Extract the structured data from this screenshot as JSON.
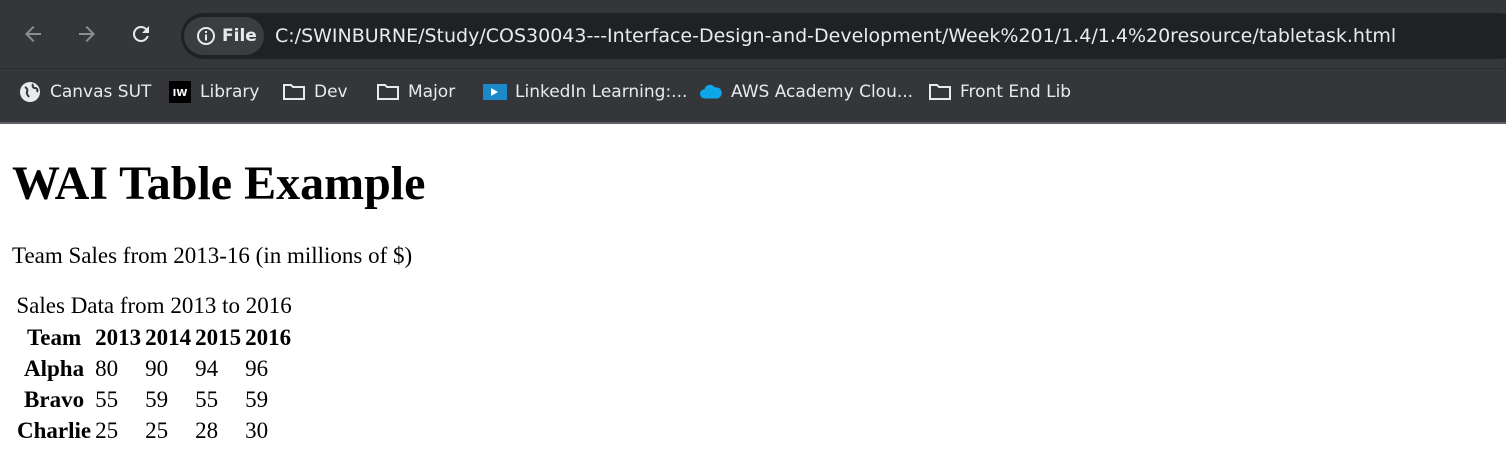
{
  "browser": {
    "nav": {
      "back_icon": "arrow-left-icon",
      "forward_icon": "arrow-right-icon",
      "reload_icon": "reload-icon"
    },
    "omnibox": {
      "scheme_chip_icon": "info-icon",
      "scheme_chip_label": "File",
      "url": "C:/SWINBURNE/Study/COS30043---Interface-Design-and-Development/Week%201/1.4/1.4%20resource/tabletask.html"
    },
    "bookmarks": [
      {
        "icon": "globe-icon",
        "label": "Canvas SUT"
      },
      {
        "icon": "iw-logo-icon",
        "label": "Library"
      },
      {
        "icon": "folder-icon",
        "label": "Dev"
      },
      {
        "icon": "folder-icon",
        "label": "Major"
      },
      {
        "icon": "linkedin-learning-icon",
        "label": "LinkedIn Learning:..."
      },
      {
        "icon": "cloud-icon",
        "label": "AWS Academy Clou..."
      },
      {
        "icon": "folder-icon",
        "label": "Front End Lib"
      }
    ],
    "colors": {
      "toolbar_bg": "#35363a",
      "omnibox_bg": "#202124",
      "text": "#e8eaed"
    }
  },
  "page": {
    "title": "WAI Table Example",
    "intro": "Team Sales from 2013-16 (in millions of $)",
    "table": {
      "caption": "Sales Data from 2013 to 2016",
      "headers": [
        "Team",
        "2013",
        "2014",
        "2015",
        "2016"
      ],
      "rows": [
        {
          "team": "Alpha",
          "values": [
            "80",
            "90",
            "94",
            "96"
          ]
        },
        {
          "team": "Bravo",
          "values": [
            "55",
            "59",
            "55",
            "59"
          ]
        },
        {
          "team": "Charlie",
          "values": [
            "25",
            "25",
            "28",
            "30"
          ]
        }
      ]
    }
  }
}
